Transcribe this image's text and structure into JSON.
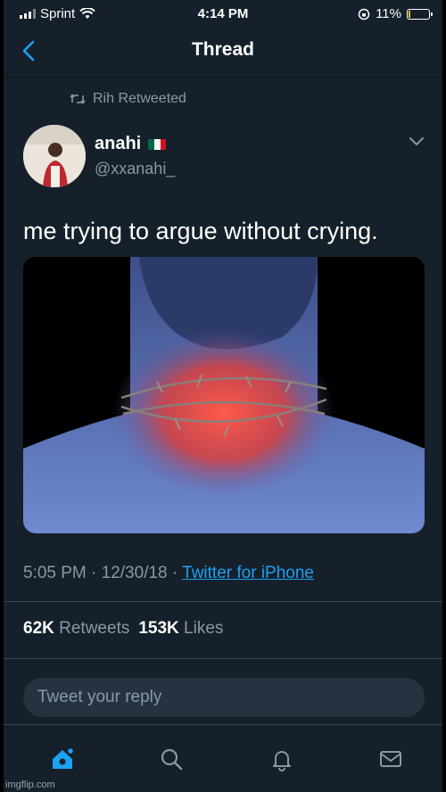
{
  "status_bar": {
    "carrier": "Sprint",
    "time": "4:14 PM",
    "battery": "11%",
    "battery_level": 0.11
  },
  "nav": {
    "title": "Thread"
  },
  "retweet": {
    "label": "Rih Retweeted"
  },
  "tweet": {
    "author_name": "anahi",
    "handle": "@xxanahi_",
    "text": "me trying to argue without crying.",
    "time": "5:05 PM · 12/30/18 · ",
    "source": "Twitter for iPhone"
  },
  "stats": {
    "retweets_count": "62K",
    "retweets_label": "Retweets",
    "likes_count": "153K",
    "likes_label": "Likes"
  },
  "reply": {
    "placeholder": "Tweet your reply"
  },
  "tabs": [
    "home-icon",
    "search-icon",
    "notifications-icon",
    "messages-icon"
  ],
  "colors": {
    "background": "#15202b",
    "accent": "#1da1f2",
    "secondary_text": "#8899a6"
  },
  "watermark": "imgflip.com"
}
